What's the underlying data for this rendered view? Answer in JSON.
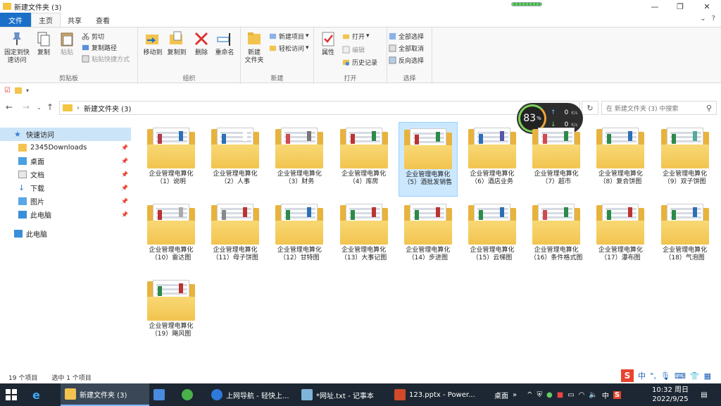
{
  "window": {
    "title": "新建文件夹 (3)",
    "minimize": "—",
    "maximize": "❐",
    "close": "✕"
  },
  "tabs": [
    {
      "label": "文件"
    },
    {
      "label": "主页"
    },
    {
      "label": "共享"
    },
    {
      "label": "查看"
    }
  ],
  "ribbon": {
    "clipboard": {
      "label": "剪贴板",
      "pin": "固定到快\n速访问",
      "copy": "复制",
      "paste": "粘贴",
      "cut": "剪切",
      "copy_path": "复制路径",
      "paste_shortcut": "粘贴快捷方式"
    },
    "organize": {
      "label": "组织",
      "move_to": "移动到",
      "copy_to": "复制到",
      "delete": "删除",
      "rename": "重命名"
    },
    "new": {
      "label": "新建",
      "new_folder": "新建\n文件夹",
      "new_item": "新建项目",
      "easy_access": "轻松访问"
    },
    "open": {
      "label": "打开",
      "properties": "属性",
      "open": "打开",
      "edit": "编辑",
      "history": "历史记录"
    },
    "select": {
      "label": "选择",
      "select_all": "全部选择",
      "select_none": "全部取消",
      "invert": "反向选择"
    }
  },
  "address": {
    "path": "新建文件夹 (3)",
    "search_placeholder": "在 新建文件夹 (3) 中搜索"
  },
  "nav": {
    "items": [
      {
        "label": "快速访问"
      },
      {
        "label": "2345Downloads"
      },
      {
        "label": "桌面"
      },
      {
        "label": "文档"
      },
      {
        "label": "下载"
      },
      {
        "label": "图片"
      },
      {
        "label": "此电脑"
      },
      {
        "label": "此电脑"
      }
    ]
  },
  "folders": [
    {
      "line1": "企业管理电算化",
      "line2": "（1）说明"
    },
    {
      "line1": "企业管理电算化",
      "line2": "（2）人事"
    },
    {
      "line1": "企业管理电算化",
      "line2": "（3）财务"
    },
    {
      "line1": "企业管理电算化",
      "line2": "（4）库房"
    },
    {
      "line1": "企业管理电算化",
      "line2": "（5）酒批发销售"
    },
    {
      "line1": "企业管理电算化",
      "line2": "（6）酒店业务"
    },
    {
      "line1": "企业管理电算化",
      "line2": "（7）超市"
    },
    {
      "line1": "企业管理电算化",
      "line2": "（8）复合饼图"
    },
    {
      "line1": "企业管理电算化",
      "line2": "（9）双子饼图"
    },
    {
      "line1": "企业管理电算化",
      "line2": "（10）雷达图"
    },
    {
      "line1": "企业管理电算化",
      "line2": "（11）母子饼图"
    },
    {
      "line1": "企业管理电算化",
      "line2": "（12）甘特图"
    },
    {
      "line1": "企业管理电算化",
      "line2": "（13）大事记图"
    },
    {
      "line1": "企业管理电算化",
      "line2": "（14）步进图"
    },
    {
      "line1": "企业管理电算化",
      "line2": "（15）云梯图"
    },
    {
      "line1": "企业管理电算化",
      "line2": "（16）条件格式图"
    },
    {
      "line1": "企业管理电算化",
      "line2": "（17）瀑布图"
    },
    {
      "line1": "企业管理电算化",
      "line2": "（18）气泡图"
    },
    {
      "line1": "企业管理电算化",
      "line2": "（19）飓风图"
    }
  ],
  "status": {
    "count": "19 个项目",
    "selected": "选中 1 个项目"
  },
  "speed": {
    "percent": "83",
    "unit": "%",
    "up": "0",
    "down": "0",
    "rate_unit": "K/s"
  },
  "ime": {
    "logo": "S",
    "lang": "中"
  },
  "taskbar": {
    "explorer": "新建文件夹 (3)",
    "browser": "上网导航 - 轻快上...",
    "notepad": "*网址.txt - 记事本",
    "ppt": "123.pptx - Power...",
    "desktop": "桌面",
    "chevron": "»",
    "tray_lang": "中",
    "time": "10:32 周日",
    "date": "2022/9/25"
  }
}
